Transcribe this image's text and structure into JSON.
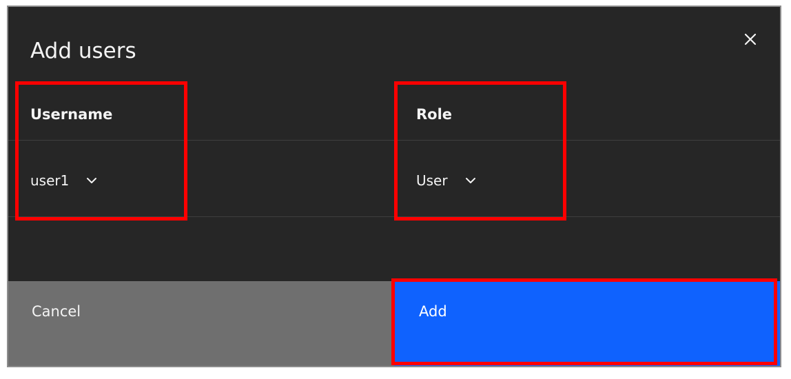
{
  "modal": {
    "title": "Add users",
    "close_icon": "close-icon"
  },
  "columns": {
    "username": {
      "header": "Username",
      "selected": "user1",
      "icon": "chevron-down-icon"
    },
    "role": {
      "header": "Role",
      "selected": "User",
      "icon": "chevron-down-icon"
    }
  },
  "footer": {
    "cancel_label": "Cancel",
    "add_label": "Add"
  },
  "colors": {
    "modal_background": "#262626",
    "cancel_button": "#6f6f6f",
    "primary_button": "#0f62fe",
    "highlight_box": "#ff0000",
    "text": "#f4f4f4"
  }
}
